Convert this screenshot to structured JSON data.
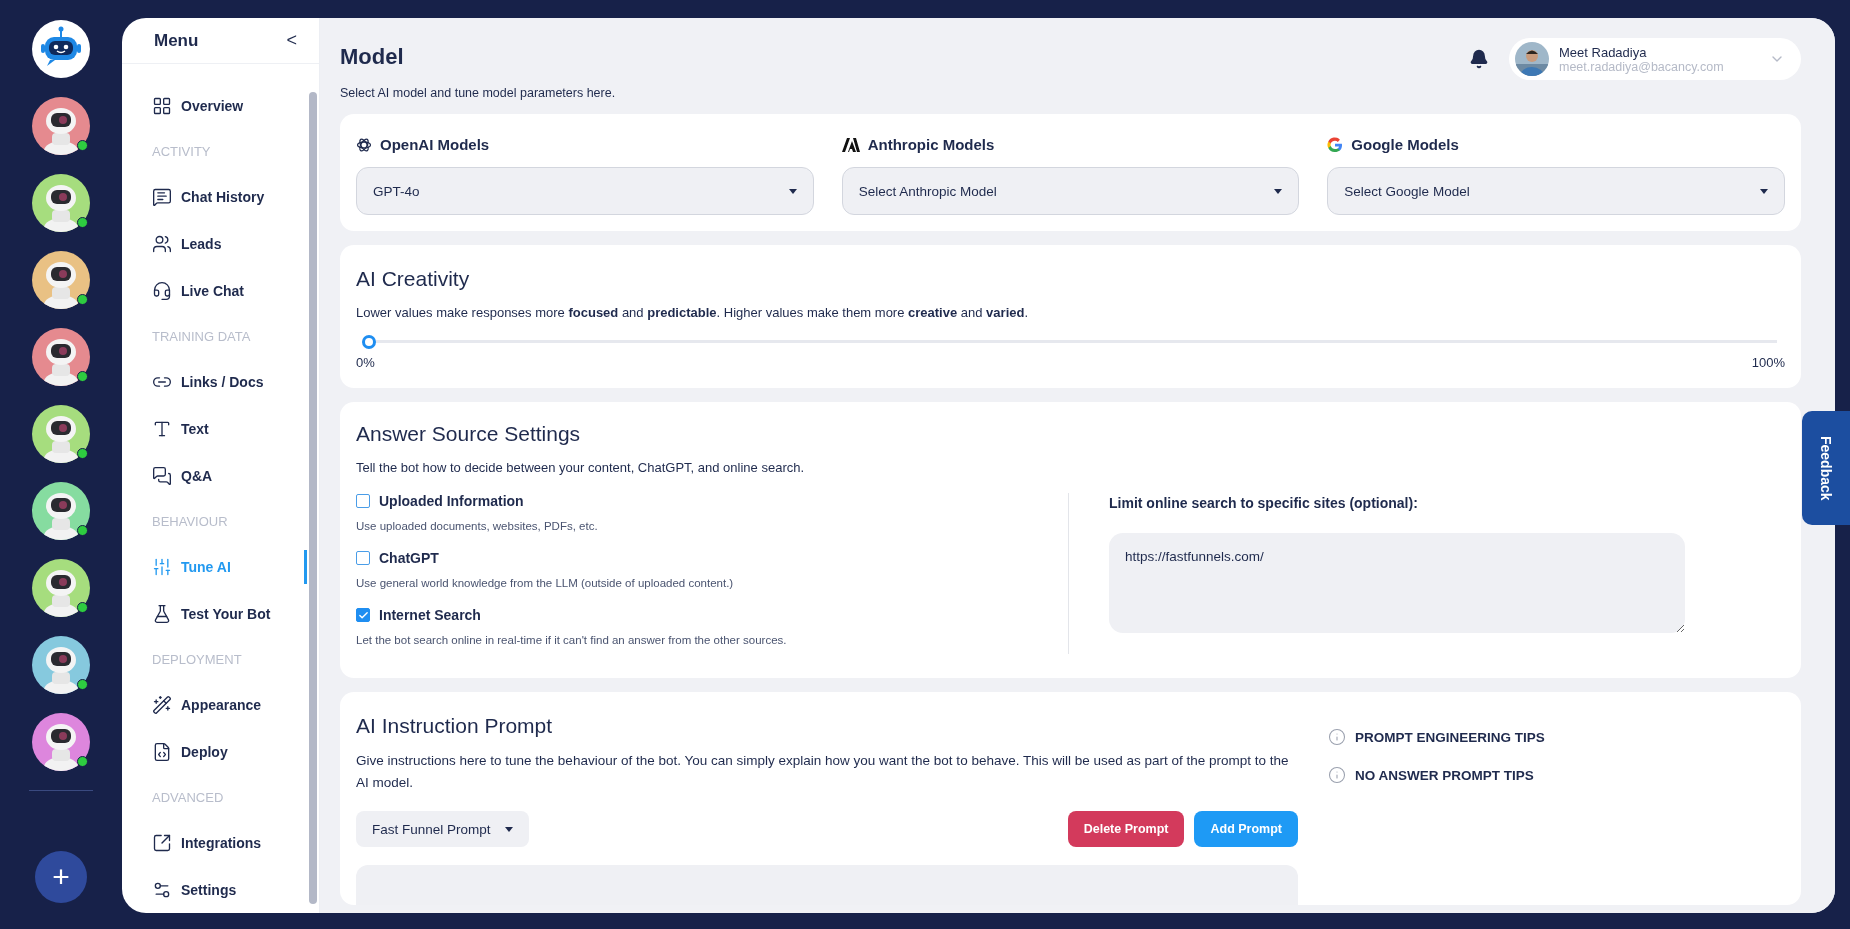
{
  "rail": {
    "bots": [
      {
        "color": "#e58a8f"
      },
      {
        "color": "#a6dd7e"
      },
      {
        "color": "#e9c184"
      },
      {
        "color": "#e58a8f"
      },
      {
        "color": "#a6dd7e"
      },
      {
        "color": "#86dca0"
      },
      {
        "color": "#a6dd7e"
      },
      {
        "color": "#86c9de"
      },
      {
        "color": "#dd86dd"
      }
    ],
    "add_label": "+"
  },
  "sidebar": {
    "title": "Menu",
    "collapse": "<",
    "items": [
      {
        "kind": "item",
        "label": "Overview",
        "selected": false
      },
      {
        "kind": "section",
        "label": "ACTIVITY"
      },
      {
        "kind": "item",
        "label": "Chat History",
        "selected": false
      },
      {
        "kind": "item",
        "label": "Leads",
        "selected": false
      },
      {
        "kind": "item",
        "label": "Live Chat",
        "selected": false
      },
      {
        "kind": "section",
        "label": "TRAINING DATA"
      },
      {
        "kind": "item",
        "label": "Links / Docs",
        "selected": false
      },
      {
        "kind": "item",
        "label": "Text",
        "selected": false
      },
      {
        "kind": "item",
        "label": "Q&A",
        "selected": false
      },
      {
        "kind": "section",
        "label": "BEHAVIOUR"
      },
      {
        "kind": "item",
        "label": "Tune AI",
        "selected": true
      },
      {
        "kind": "item",
        "label": "Test Your Bot",
        "selected": false
      },
      {
        "kind": "section",
        "label": "DEPLOYMENT"
      },
      {
        "kind": "item",
        "label": "Appearance",
        "selected": false
      },
      {
        "kind": "item",
        "label": "Deploy",
        "selected": false
      },
      {
        "kind": "section",
        "label": "ADVANCED"
      },
      {
        "kind": "item",
        "label": "Integrations",
        "selected": false
      },
      {
        "kind": "item",
        "label": "Settings",
        "selected": false
      }
    ]
  },
  "header": {
    "title": "Model",
    "subtitle": "Select AI model and tune model parameters here.",
    "user": {
      "name": "Meet Radadiya",
      "email": "meet.radadiya@bacancy.com"
    }
  },
  "models": [
    {
      "label": "OpenAI Models",
      "value": "GPT-4o"
    },
    {
      "label": "Anthropic Models",
      "placeholder": "Select Anthropic Model"
    },
    {
      "label": "Google Models",
      "placeholder": "Select Google Model"
    }
  ],
  "creativity": {
    "title": "AI Creativity",
    "description": "Lower values make responses more **focused** and **predictable**. Higher values make them more **creative** and **varied**.",
    "level": 0,
    "min_label": "0%",
    "max_label": "100%"
  },
  "answer_source": {
    "title": "Answer Source Settings",
    "description": "Tell the bot how to decide between your content, ChatGPT, and online search.",
    "options": [
      {
        "label": "Uploaded Information",
        "hint": "Use uploaded documents, websites, PDFs, etc.",
        "checked": false
      },
      {
        "label": "ChatGPT",
        "hint": "Use general world knowledge from the LLM (outside of uploaded content.)",
        "checked": false
      },
      {
        "label": "Internet Search",
        "hint": "Let the bot search online in real-time if it can't find an answer from the other sources.",
        "checked": true
      }
    ],
    "sites_label": "Limit online search to specific sites (optional):",
    "sites_value": "https://fastfunnels.com/"
  },
  "instruction": {
    "title": "AI Instruction Prompt",
    "description": "Give instructions here to tune the behaviour of the bot. You can simply explain how you want the bot to behave. This will be used as part of the prompt to the AI model.",
    "prompt_select": "Fast Funnel Prompt",
    "buttons": [
      {
        "kind": "danger",
        "label": "Delete Prompt"
      },
      {
        "kind": "primary",
        "label": "Add Prompt"
      }
    ],
    "tips": [
      "PROMPT ENGINEERING TIPS",
      "NO ANSWER PROMPT TIPS"
    ]
  },
  "feedback": "Feedback"
}
